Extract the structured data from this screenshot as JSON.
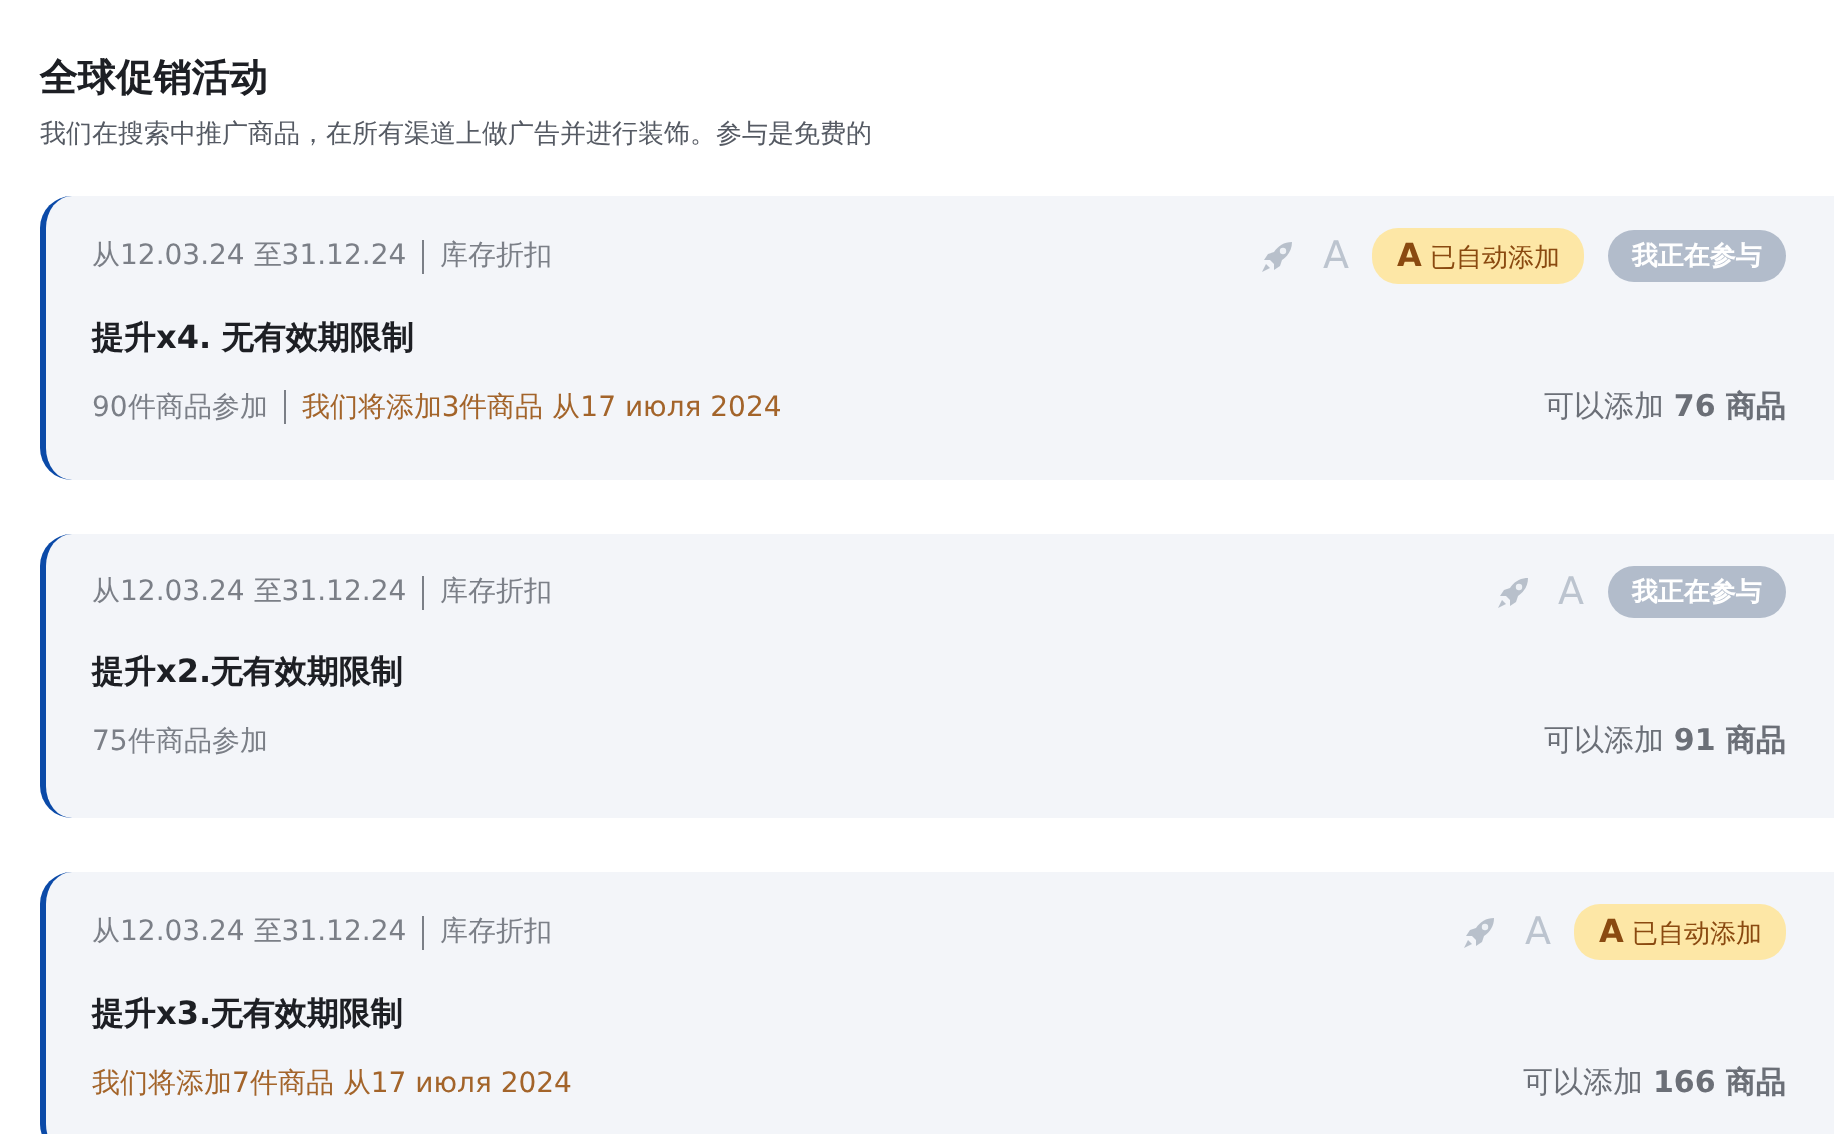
{
  "header": {
    "title": "全球促销活动",
    "subtitle": "我们在搜索中推广商品，在所有渠道上做广告并进行装饰。参与是免费的"
  },
  "cards": [
    {
      "period": "从12.03.24 至31.12.24",
      "type": "库存折扣",
      "title": "提升x4. 无有效期限制",
      "participants": "90件商品参加",
      "note": "我们将添加3件商品 从17 июля 2024",
      "can_add": "可以添加 **76 商品**",
      "letter": "A",
      "badges": [
        {
          "kind": "auto",
          "icon": "A",
          "label": "已自动添加"
        },
        {
          "kind": "participating",
          "label": "我正在参与"
        }
      ]
    },
    {
      "period": "从12.03.24 至31.12.24",
      "type": "库存折扣",
      "title": "提升x2.无有效期限制",
      "participants": "75件商品参加",
      "can_add": "可以添加 **91 商品**",
      "letter": "A",
      "badges": [
        {
          "kind": "participating",
          "label": "我正在参与"
        }
      ]
    },
    {
      "period": "从12.03.24 至31.12.24",
      "type": "库存折扣",
      "title": "提升x3.无有效期限制",
      "note": "我们将添加7件商品 从17 июля 2024",
      "can_add": "可以添加 **166 商品**",
      "letter": "A",
      "badges": [
        {
          "kind": "auto",
          "icon": "A",
          "label": "已自动添加"
        }
      ]
    }
  ]
}
